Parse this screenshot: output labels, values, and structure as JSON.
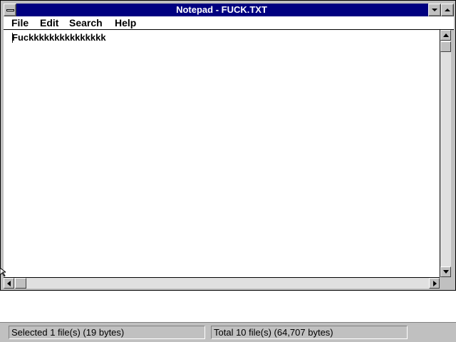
{
  "window": {
    "title": "Notepad - FUCK.TXT"
  },
  "menubar": {
    "items": [
      {
        "label": "File"
      },
      {
        "label": "Edit"
      },
      {
        "label": "Search"
      },
      {
        "label": "Help"
      }
    ]
  },
  "editor": {
    "content": "Fuckkkkkkkkkkkkkkk"
  },
  "statusbar": {
    "selected": "Selected 1 file(s) (19 bytes)",
    "total": "Total 10 file(s) (64,707 bytes)"
  },
  "colors": {
    "titlebar": "#000080",
    "face": "#c0c0c0",
    "window_bg": "#ffffff"
  },
  "icons": [
    "system-menu-icon",
    "minimize-icon",
    "maximize-icon",
    "scroll-up-arrow-icon",
    "scroll-down-arrow-icon",
    "scroll-left-arrow-icon",
    "scroll-right-arrow-icon"
  ]
}
